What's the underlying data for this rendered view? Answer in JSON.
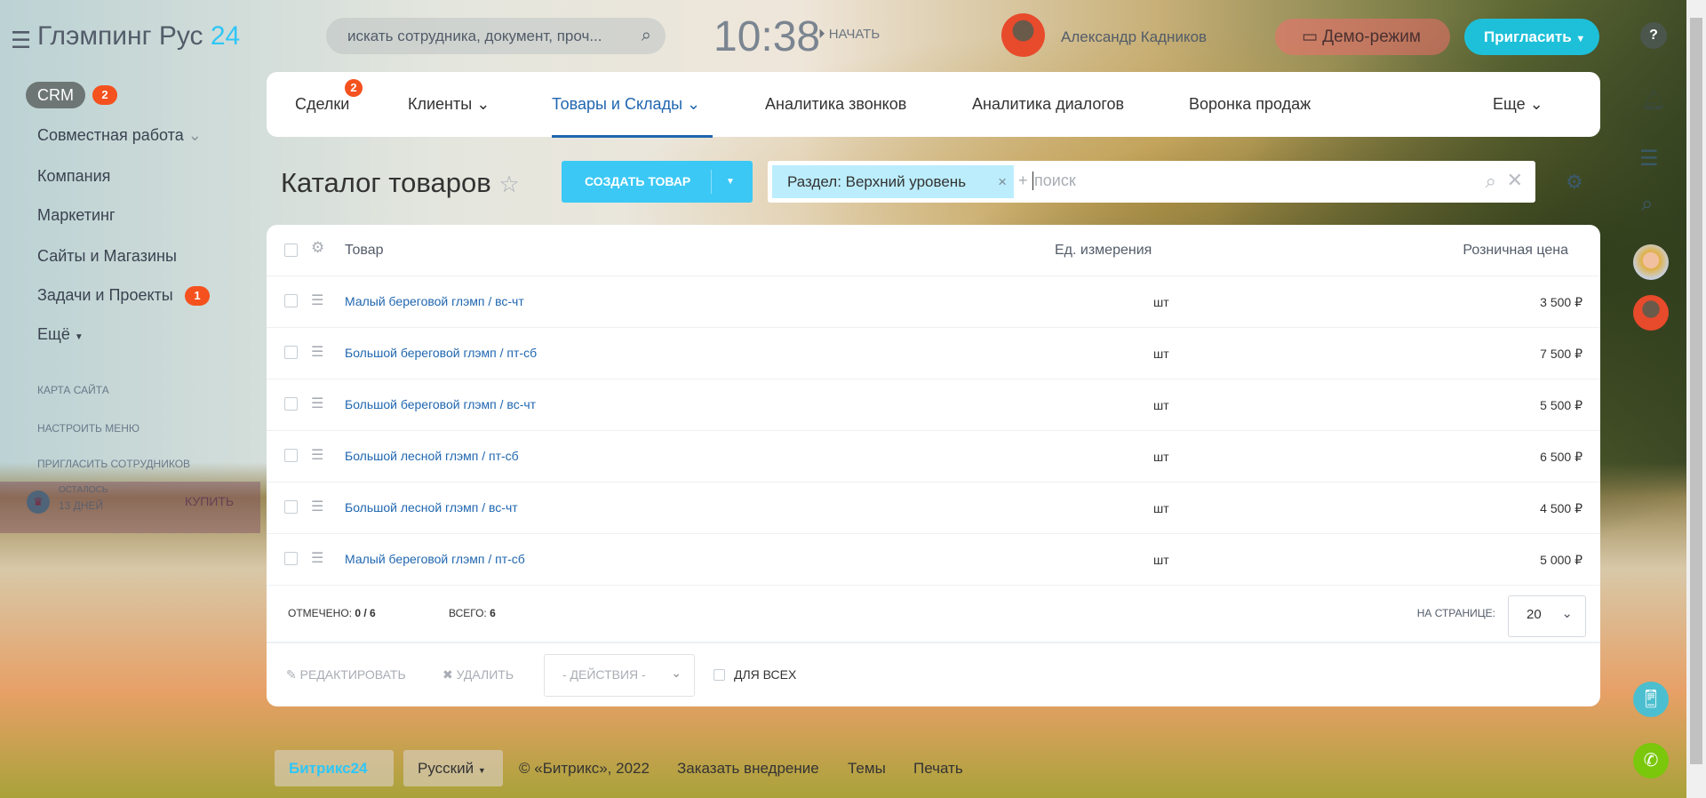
{
  "header": {
    "logo_text": "Глэмпинг Рус",
    "logo_suffix": "24",
    "search_placeholder": "искать сотрудника, документ, проч...",
    "clock": "10:38",
    "start_label": "НАЧАТЬ",
    "user_name": "Александр Кадников",
    "demo_label": "Демо-режим",
    "invite_label": "Пригласить",
    "help_label": "?"
  },
  "sidebar": {
    "items": [
      {
        "label": "CRM",
        "badge": "2"
      },
      {
        "label": "Совместная работа"
      },
      {
        "label": "Компания"
      },
      {
        "label": "Маркетинг"
      },
      {
        "label": "Сайты и Магазины"
      },
      {
        "label": "Задачи и Проекты",
        "badge": "1"
      },
      {
        "label": "Ещё"
      }
    ],
    "site_map": "КАРТА САЙТА",
    "configure_menu": "НАСТРОИТЬ МЕНЮ",
    "invite_employees": "ПРИГЛАСИТЬ СОТРУДНИКОВ",
    "trial_left": "ОСТАЛОСЬ",
    "trial_days": "13 ДНЕЙ",
    "buy": "КУПИТЬ"
  },
  "tabs": [
    {
      "label": "Сделки",
      "badge": "2"
    },
    {
      "label": "Клиенты"
    },
    {
      "label": "Товары и Склады"
    },
    {
      "label": "Аналитика звонков"
    },
    {
      "label": "Аналитика диалогов"
    },
    {
      "label": "Воронка продаж"
    },
    {
      "label": "Еще"
    }
  ],
  "page": {
    "title": "Каталог товаров",
    "create_label": "СОЗДАТЬ ТОВАР",
    "filter_chip": "Раздел: Верхний уровень",
    "filter_placeholder": "поиск"
  },
  "table": {
    "columns": [
      "Товар",
      "Ед. измерения",
      "Розничная цена"
    ],
    "rows": [
      {
        "name": "Малый береговой глэмп / вс-чт",
        "unit": "шт",
        "price": "3 500 ₽"
      },
      {
        "name": "Большой береговой глэмп / пт-сб",
        "unit": "шт",
        "price": "7 500 ₽"
      },
      {
        "name": "Большой береговой глэмп / вс-чт",
        "unit": "шт",
        "price": "5 500 ₽"
      },
      {
        "name": "Большой лесной глэмп / пт-сб",
        "unit": "шт",
        "price": "6 500 ₽"
      },
      {
        "name": "Большой лесной глэмп / вс-чт",
        "unit": "шт",
        "price": "4 500 ₽"
      },
      {
        "name": "Малый береговой глэмп / пт-сб",
        "unit": "шт",
        "price": "5 000 ₽"
      }
    ],
    "selected_label": "ОТМЕЧЕНО:",
    "selected_value": "0 / 6",
    "total_label": "ВСЕГО:",
    "total_value": "6",
    "per_page_label": "НА СТРАНИЦЕ:",
    "per_page_value": "20",
    "edit_label": "РЕДАКТИРОВАТЬ",
    "delete_label": "УДАЛИТЬ",
    "actions_label": "- ДЕЙСТВИЯ -",
    "for_all_label": "ДЛЯ ВСЕХ"
  },
  "footer": {
    "brand": "Битрикс24",
    "language": "Русский",
    "copyright": "© «Битрикс», 2022",
    "order": "Заказать внедрение",
    "themes": "Темы",
    "print": "Печать"
  }
}
